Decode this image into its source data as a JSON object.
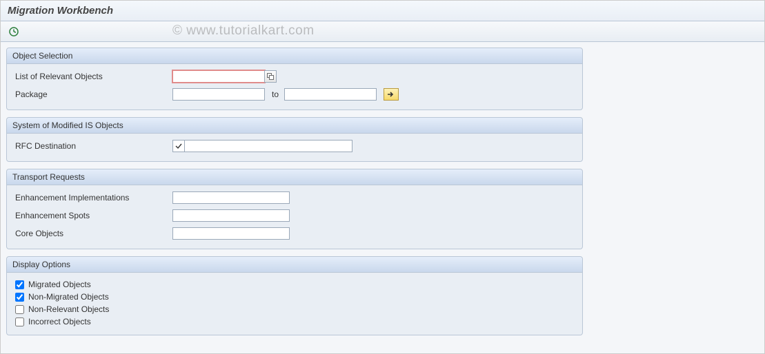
{
  "title": "Migration Workbench",
  "watermark": "© www.tutorialkart.com",
  "toolbar": {
    "execute_icon": "execute"
  },
  "groups": {
    "object_selection": {
      "title": "Object Selection",
      "list_label": "List of Relevant Objects",
      "list_value": "",
      "package_label": "Package",
      "package_from": "",
      "to_label": "to",
      "package_to": ""
    },
    "system_modified": {
      "title": "System of Modified IS Objects",
      "rfc_label": "RFC Destination",
      "rfc_value": ""
    },
    "transport": {
      "title": "Transport Requests",
      "enh_impl_label": "Enhancement Implementations",
      "enh_impl_value": "",
      "enh_spots_label": "Enhancement Spots",
      "enh_spots_value": "",
      "core_obj_label": "Core Objects",
      "core_obj_value": ""
    },
    "display_options": {
      "title": "Display Options",
      "migrated": {
        "label": "Migrated Objects",
        "checked": true
      },
      "non_migrated": {
        "label": "Non-Migrated Objects",
        "checked": true
      },
      "non_relevant": {
        "label": "Non-Relevant Objects",
        "checked": false
      },
      "incorrect": {
        "label": "Incorrect Objects",
        "checked": false
      }
    }
  }
}
